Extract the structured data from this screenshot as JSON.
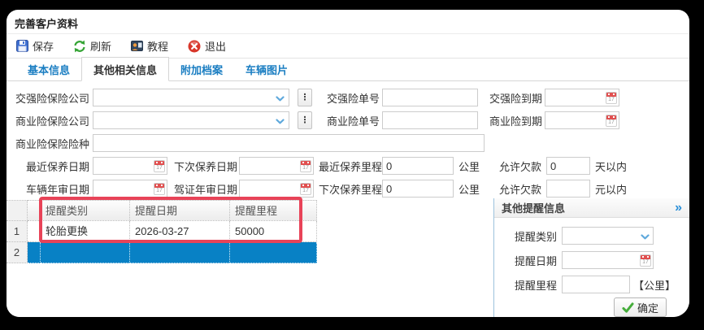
{
  "window": {
    "title": "完善客户资料"
  },
  "toolbar": {
    "save": "保存",
    "refresh": "刷新",
    "tutorial": "教程",
    "exit": "退出"
  },
  "tabs": {
    "basic": "基本信息",
    "other": "其他相关信息",
    "attachments": "附加档案",
    "photos": "车辆图片"
  },
  "form": {
    "compulsory_company_label": "交强险保险公司",
    "compulsory_no_label": "交强险单号",
    "compulsory_expiry_label": "交强险到期",
    "commercial_company_label": "商业险保险公司",
    "commercial_no_label": "商业险单号",
    "commercial_expiry_label": "商业险到期",
    "commercial_type_label": "商业险保险险种",
    "last_maintenance_date_label": "最近保养日期",
    "next_maintenance_date_label": "下次保养日期",
    "last_maintenance_mileage_label": "最近保养里程",
    "last_maintenance_mileage_value": "0",
    "next_maintenance_mileage_label": "下次保养里程",
    "next_maintenance_mileage_value": "0",
    "mileage_unit": "公里",
    "vehicle_inspection_date_label": "车辆年审日期",
    "license_inspection_date_label": "驾证年审日期",
    "allow_arrears_days_label": "允许欠款",
    "allow_arrears_days_value": "0",
    "allow_arrears_days_unit": "天以内",
    "allow_arrears_amount_label": "允许欠款",
    "allow_arrears_amount_value": "",
    "allow_arrears_amount_unit": "元以内"
  },
  "grid": {
    "columns": {
      "type": "提醒类别",
      "date": "提醒日期",
      "mileage": "提醒里程"
    },
    "rows": [
      {
        "num": "1",
        "type": "轮胎更换",
        "date": "2026-03-27",
        "mileage": "50000",
        "selected": false
      },
      {
        "num": "2",
        "type": "",
        "date": "",
        "mileage": "",
        "selected": true
      }
    ]
  },
  "panel": {
    "title": "其他提醒信息",
    "collapse_glyph": "»",
    "type_label": "提醒类别",
    "date_label": "提醒日期",
    "mileage_label": "提醒里程",
    "mileage_unit": "【公里】",
    "confirm_label": "确定"
  },
  "icons": {
    "dots_glyph": "⋮",
    "calendar_day": "17"
  },
  "colors": {
    "accent_blue": "#1b7ec2",
    "selected_row_blue": "#0881c5",
    "annotation_red": "#e84358",
    "confirm_green": "#45ad3b",
    "exit_red": "#d8372b",
    "refresh_green": "#35a435",
    "save_blue": "#3f6fd1"
  }
}
